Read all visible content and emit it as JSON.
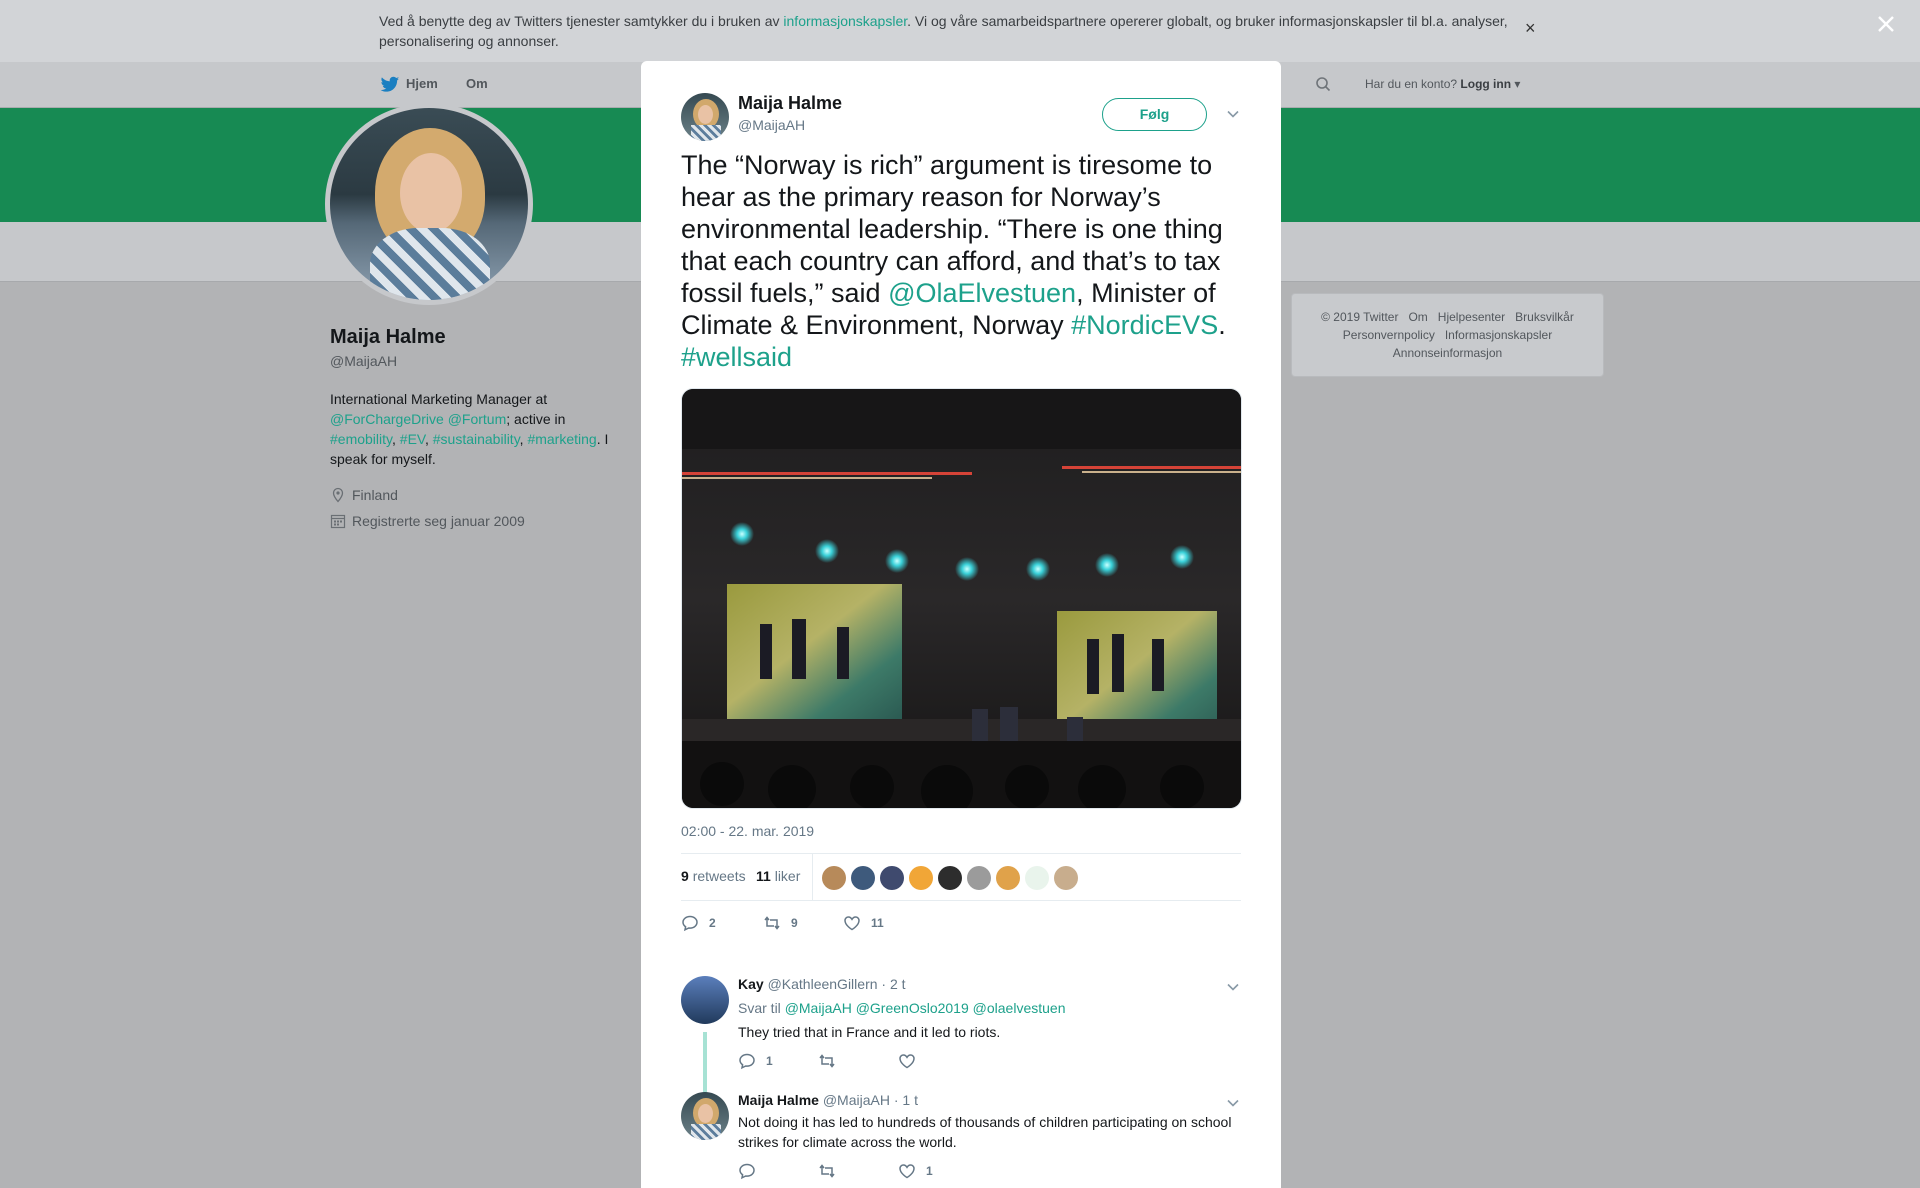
{
  "cookie": {
    "text_before": "Ved å benytte deg av Twitters tjenester samtykker du i bruken av ",
    "link": "informasjonskapsler",
    "text_after": ". Vi og våre samarbeidspartnere opererer globalt, og bruker informasjonskapsler til bl.a. analyser, personalisering og annonser.",
    "close": "×"
  },
  "nav": {
    "home": "Hjem",
    "about": "Om",
    "have_account": "Har du en konto?",
    "login": "Logg inn"
  },
  "profile": {
    "name": "Maija Halme",
    "handle": "@MaijaAH",
    "bio_1": "International Marketing Manager at ",
    "bio_link_1": "@ForChargeDrive",
    "bio_link_2": "@Fortum",
    "bio_2": "; active in ",
    "bio_tag_1": "#emobility",
    "bio_tag_2": "#EV",
    "bio_tag_3": "#sustainability",
    "bio_tag_4": "#marketing",
    "bio_3": ". I speak for myself.",
    "location": "Finland",
    "joined": "Registrerte seg januar 2009"
  },
  "footer": {
    "copyright": "© 2019 Twitter",
    "about": "Om",
    "help": "Hjelpesenter",
    "terms": "Bruksvilkår",
    "privacy": "Personvernpolicy",
    "cookies": "Informasjonskapsler",
    "ads": "Annonseinformasjon"
  },
  "tweet": {
    "name": "Maija Halme",
    "handle": "@MaijaAH",
    "follow": "Følg",
    "text_1": "The “Norway is rich” argument is tiresome to hear as the primary reason for Norway’s environmental leadership. “There is one thing that each country can afford, and that’s to tax fossil fuels,” said ",
    "mention": "@OlaElvestuen",
    "text_2": ", Minister of Climate & Environment, Norway ",
    "hashtag_1": "#NordicEVS",
    "text_3": ". ",
    "hashtag_2": "#wellsaid",
    "timestamp": "02:00 - 22. mar. 2019",
    "retweets_count": "9",
    "retweets_label": "retweets",
    "likes_count": "11",
    "likes_label": "liker",
    "reply_count": "2",
    "retweet_count": "9",
    "like_count": "11"
  },
  "replies": [
    {
      "name": "Kay",
      "handle": "@KathleenGillern",
      "time": "· 2 t",
      "reply_to_label": "Svar til",
      "reply_to_1": "@MaijaAH",
      "reply_to_2": "@GreenOslo2019",
      "reply_to_3": "@olaelvestuen",
      "text": "They tried that in France and it led to riots.",
      "reply_count": "1",
      "like_count": ""
    },
    {
      "name": "Maija Halme",
      "handle": "@MaijaAH",
      "time": "· 1 t",
      "text": "Not doing it has led to hundreds of thousands of children participating on school strikes for climate across the world.",
      "reply_count": "",
      "like_count": "1"
    }
  ],
  "colors": {
    "accent": "#1da18b",
    "banner": "#178a53"
  }
}
